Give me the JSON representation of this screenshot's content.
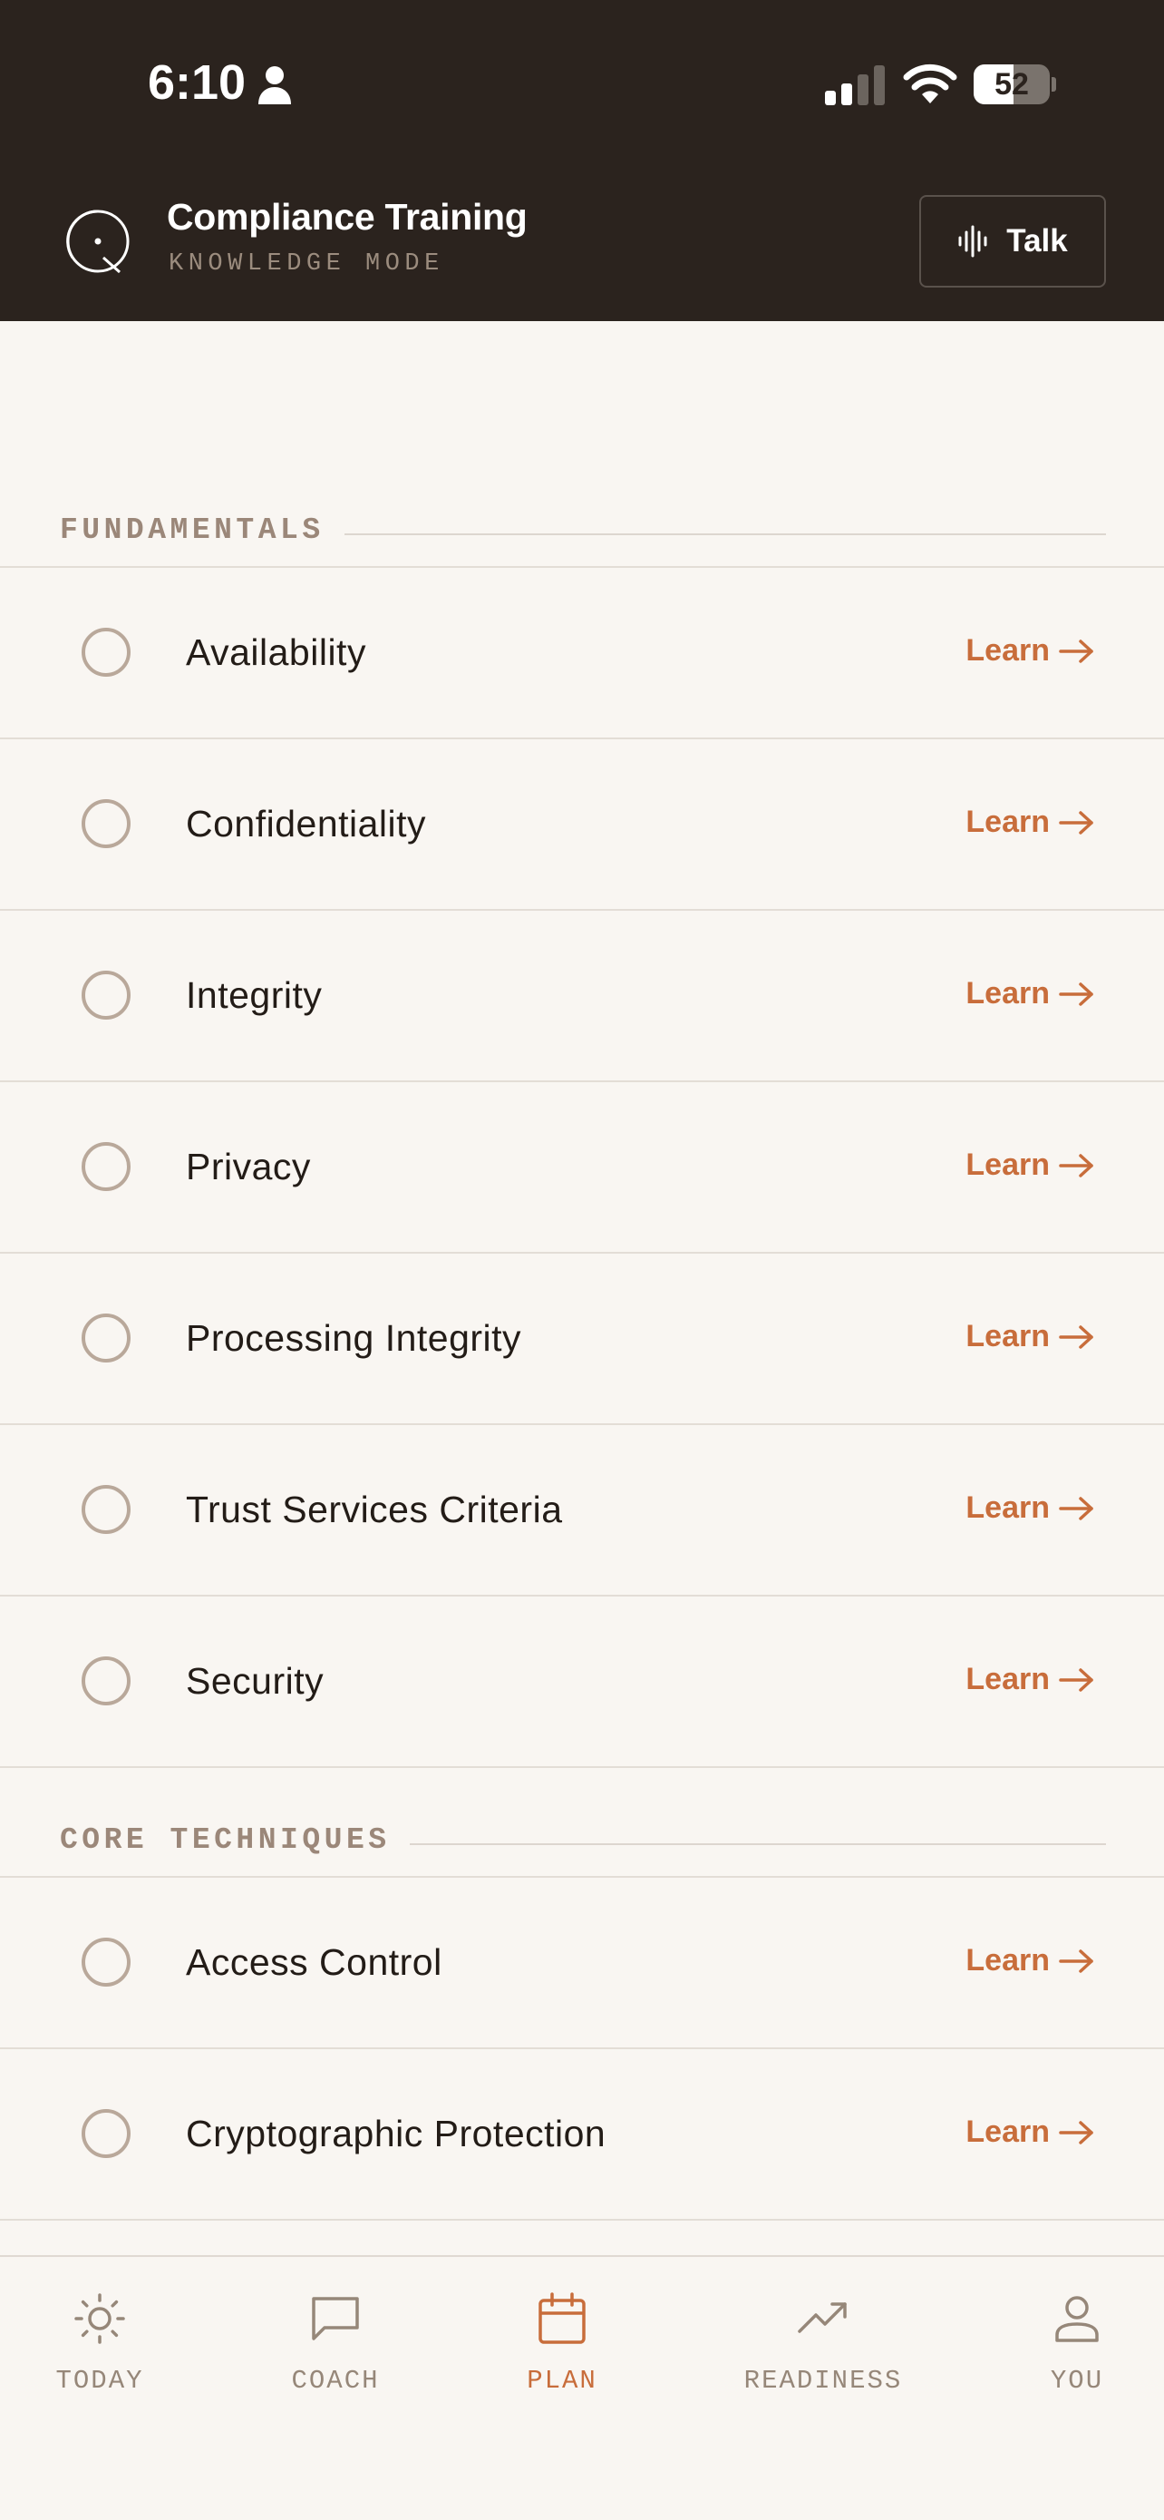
{
  "status_bar": {
    "time": "6:10",
    "battery_level": "52",
    "battery_fraction": 0.52,
    "icons": [
      "person-icon",
      "signal-icon",
      "wifi-icon",
      "battery-icon"
    ]
  },
  "header": {
    "title": "Compliance Training",
    "subtitle": "KNOWLEDGE MODE",
    "talk_label": "Talk",
    "icons": [
      "app-logo-icon",
      "waveform-icon"
    ]
  },
  "sections": [
    {
      "title": "FUNDAMENTALS",
      "items": [
        {
          "label": "Availability",
          "action": "Learn"
        },
        {
          "label": "Confidentiality",
          "action": "Learn"
        },
        {
          "label": "Integrity",
          "action": "Learn"
        },
        {
          "label": "Privacy",
          "action": "Learn"
        },
        {
          "label": "Processing Integrity",
          "action": "Learn"
        },
        {
          "label": "Trust Services Criteria",
          "action": "Learn"
        },
        {
          "label": "Security",
          "action": "Learn"
        }
      ]
    },
    {
      "title": "CORE TECHNIQUES",
      "items": [
        {
          "label": "Access Control",
          "action": "Learn"
        },
        {
          "label": "Cryptographic Protection",
          "action": "Learn"
        }
      ]
    }
  ],
  "tabs": [
    {
      "label": "TODAY",
      "icon": "sun-icon",
      "active": false
    },
    {
      "label": "COACH",
      "icon": "chat-icon",
      "active": false
    },
    {
      "label": "PLAN",
      "icon": "calendar-icon",
      "active": true
    },
    {
      "label": "READINESS",
      "icon": "trending-up-icon",
      "active": false
    },
    {
      "label": "YOU",
      "icon": "person-icon",
      "active": false
    }
  ],
  "colors": {
    "header_bg": "#2b231e",
    "page_bg": "#f9f6f2",
    "accent": "#c86d3b",
    "muted": "#968779"
  }
}
